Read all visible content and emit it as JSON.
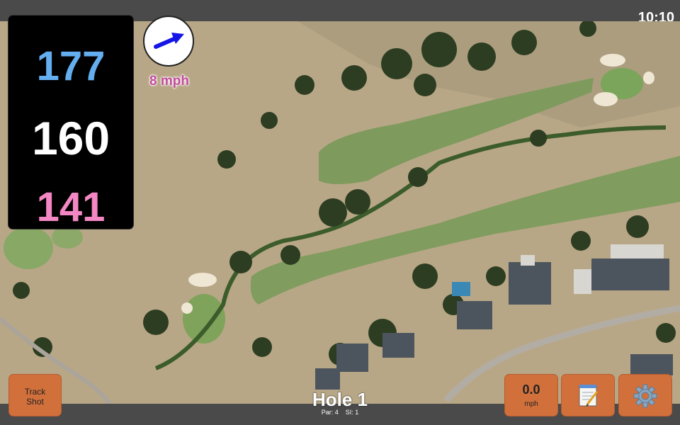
{
  "status": {
    "time": "10:10"
  },
  "distances": {
    "back": "177",
    "middle": "160",
    "front": "141"
  },
  "wind": {
    "speed_label": "8 mph",
    "direction_icon": "wind-arrow-icon"
  },
  "hole": {
    "title": "Hole 1",
    "par": "Par: 4",
    "stroke_index": "SI: 1"
  },
  "buttons": {
    "track_shot_line1": "Track",
    "track_shot_line2": "Shot",
    "wind_value": "0.0",
    "wind_unit": "mph",
    "notes_icon": "notepad-icon",
    "settings_icon": "gear-icon"
  },
  "colors": {
    "accent_button": "#d2703c",
    "back_distance": "#64aef0",
    "middle_distance": "#ffffff",
    "front_distance": "#f387c3",
    "wind_text": "#c14c9b"
  }
}
